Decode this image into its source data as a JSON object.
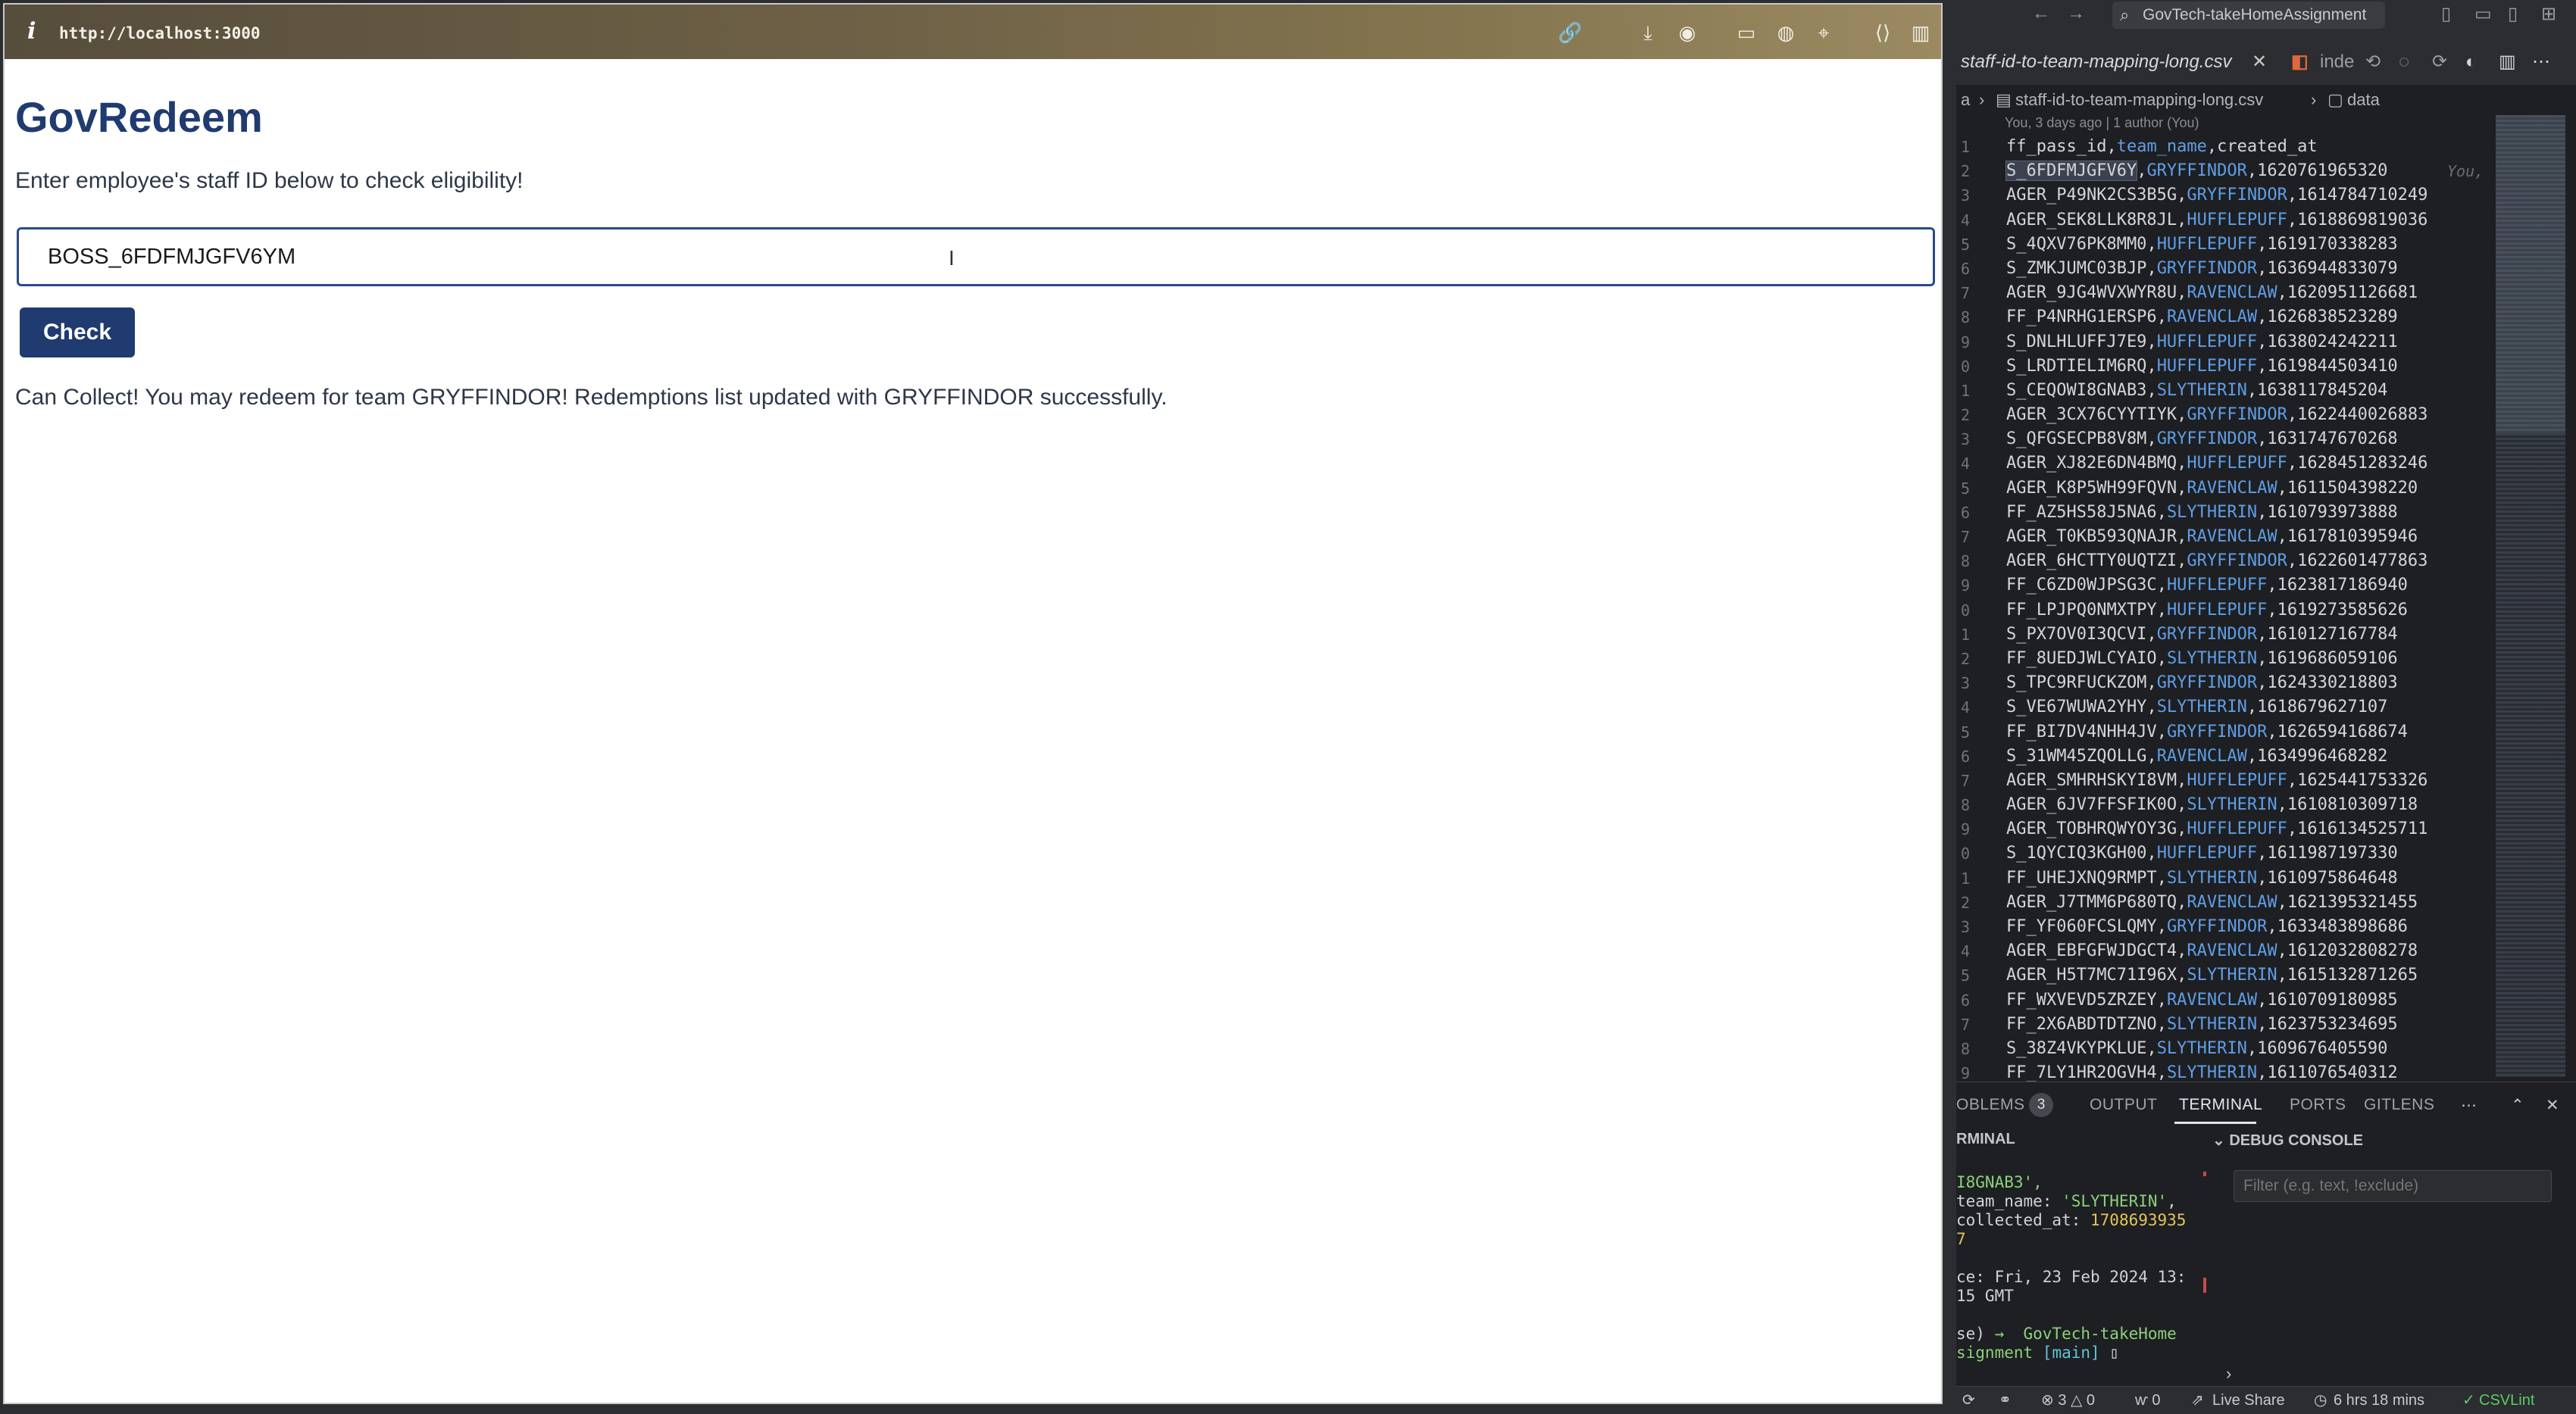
{
  "browser": {
    "url": "http://localhost:3000",
    "title": "GovRedeem",
    "prompt": "Enter employee's staff ID below to check eligibility!",
    "input_value": "BOSS_6FDFMJGFV6YM",
    "check_label": "Check",
    "result": "Can Collect! You may redeem for team GRYFFINDOR! Redemptions list updated with GRYFFINDOR successfully."
  },
  "editor": {
    "search": "GovTech-takeHomeAssignment",
    "tabs": [
      "staff-id-to-team-mapping-long.csv",
      "inde"
    ],
    "breadcrumb": [
      "a",
      "staff-id-to-team-mapping-long.csv",
      "data"
    ],
    "blame": "You, 3 days ago | 1 author (You)",
    "ghost_text": "You,",
    "header_line": {
      "cols": [
        "ff_pass_id",
        "team_name",
        "created_at"
      ]
    },
    "rows": [
      {
        "ln": "2",
        "id": "S_6FDFMJGFV6Y",
        "team": "GRYFFINDOR",
        "ts": "1620761965320"
      },
      {
        "ln": "3",
        "id": "AGER_P49NK2CS3B5G",
        "team": "GRYFFINDOR",
        "ts": "1614784710249"
      },
      {
        "ln": "4",
        "id": "AGER_SEK8LLK8R8JL",
        "team": "HUFFLEPUFF",
        "ts": "1618869819036"
      },
      {
        "ln": "5",
        "id": "S_4QXV76PK8MM0",
        "team": "HUFFLEPUFF",
        "ts": "1619170338283"
      },
      {
        "ln": "6",
        "id": "S_ZMKJUMC03BJP",
        "team": "GRYFFINDOR",
        "ts": "1636944833079"
      },
      {
        "ln": "7",
        "id": "AGER_9JG4WVXWYR8U",
        "team": "RAVENCLAW",
        "ts": "1620951126681"
      },
      {
        "ln": "8",
        "id": "FF_P4NRHG1ERSP6",
        "team": "RAVENCLAW",
        "ts": "1626838523289"
      },
      {
        "ln": "9",
        "id": "S_DNLHLUFFJ7E9",
        "team": "HUFFLEPUFF",
        "ts": "1638024242211"
      },
      {
        "ln": "0",
        "id": "S_LRDTIELIM6RQ",
        "team": "HUFFLEPUFF",
        "ts": "1619844503410"
      },
      {
        "ln": "1",
        "id": "S_CEQOWI8GNAB3",
        "team": "SLYTHERIN",
        "ts": "1638117845204"
      },
      {
        "ln": "2",
        "id": "AGER_3CX76CYYTIYK",
        "team": "GRYFFINDOR",
        "ts": "1622440026883"
      },
      {
        "ln": "3",
        "id": "S_QFGSECPB8V8M",
        "team": "GRYFFINDOR",
        "ts": "1631747670268"
      },
      {
        "ln": "4",
        "id": "AGER_XJ82E6DN4BMQ",
        "team": "HUFFLEPUFF",
        "ts": "1628451283246"
      },
      {
        "ln": "5",
        "id": "AGER_K8P5WH99FQVN",
        "team": "RAVENCLAW",
        "ts": "1611504398220"
      },
      {
        "ln": "6",
        "id": "FF_AZ5HS58J5NA6",
        "team": "SLYTHERIN",
        "ts": "1610793973888"
      },
      {
        "ln": "7",
        "id": "AGER_T0KB593QNAJR",
        "team": "RAVENCLAW",
        "ts": "1617810395946"
      },
      {
        "ln": "8",
        "id": "AGER_6HCTTY0UQTZI",
        "team": "GRYFFINDOR",
        "ts": "1622601477863"
      },
      {
        "ln": "9",
        "id": "FF_C6ZD0WJPSG3C",
        "team": "HUFFLEPUFF",
        "ts": "1623817186940"
      },
      {
        "ln": "0",
        "id": "FF_LPJPQ0NMXTPY",
        "team": "HUFFLEPUFF",
        "ts": "1619273585626"
      },
      {
        "ln": "1",
        "id": "S_PX7OV0I3QCVI",
        "team": "GRYFFINDOR",
        "ts": "1610127167784"
      },
      {
        "ln": "2",
        "id": "FF_8UEDJWLCYAIO",
        "team": "SLYTHERIN",
        "ts": "1619686059106"
      },
      {
        "ln": "3",
        "id": "S_TPC9RFUCKZOM",
        "team": "GRYFFINDOR",
        "ts": "1624330218803"
      },
      {
        "ln": "4",
        "id": "S_VE67WUWA2YHY",
        "team": "SLYTHERIN",
        "ts": "1618679627107"
      },
      {
        "ln": "5",
        "id": "FF_BI7DV4NHH4JV",
        "team": "GRYFFINDOR",
        "ts": "1626594168674"
      },
      {
        "ln": "6",
        "id": "S_31WM45ZQOLLG",
        "team": "RAVENCLAW",
        "ts": "1634996468282"
      },
      {
        "ln": "7",
        "id": "AGER_SMHRHSKYI8VM",
        "team": "HUFFLEPUFF",
        "ts": "1625441753326"
      },
      {
        "ln": "8",
        "id": "AGER_6JV7FFSFIK0O",
        "team": "SLYTHERIN",
        "ts": "1610810309718"
      },
      {
        "ln": "9",
        "id": "AGER_TOBHRQWYOY3G",
        "team": "HUFFLEPUFF",
        "ts": "1616134525711"
      },
      {
        "ln": "0",
        "id": "S_1QYCIQ3KGH00",
        "team": "HUFFLEPUFF",
        "ts": "1611987197330"
      },
      {
        "ln": "1",
        "id": "FF_UHEJXNQ9RMPT",
        "team": "SLYTHERIN",
        "ts": "1610975864648"
      },
      {
        "ln": "2",
        "id": "AGER_J7TMM6P680TQ",
        "team": "RAVENCLAW",
        "ts": "1621395321455"
      },
      {
        "ln": "3",
        "id": "FF_YF060FCSLQMY",
        "team": "GRYFFINDOR",
        "ts": "1633483898686"
      },
      {
        "ln": "4",
        "id": "AGER_EBFGFWJDGCT4",
        "team": "RAVENCLAW",
        "ts": "1612032808278"
      },
      {
        "ln": "5",
        "id": "AGER_H5T7MC71I96X",
        "team": "SLYTHERIN",
        "ts": "1615132871265"
      },
      {
        "ln": "6",
        "id": "FF_WXVEVD5ZRZEY",
        "team": "RAVENCLAW",
        "ts": "1610709180985"
      },
      {
        "ln": "7",
        "id": "FF_2X6ABDTDTZNO",
        "team": "SLYTHERIN",
        "ts": "1623753234695"
      },
      {
        "ln": "8",
        "id": "S_38Z4VKYPKLUE",
        "team": "SLYTHERIN",
        "ts": "1609676405590"
      },
      {
        "ln": "9",
        "id": "FF_7LY1HR2OGVH4",
        "team": "SLYTHERIN",
        "ts": "1611076540312"
      }
    ],
    "panel": {
      "tabs": [
        "OBLEMS",
        "OUTPUT",
        "TERMINAL",
        "PORTS",
        "GITLENS"
      ],
      "problems_count": "3",
      "terminal_title": "RMINAL",
      "debug_title": "DEBUG CONSOLE",
      "filter_placeholder": "Filter (e.g. text, !exclude)",
      "terminal_lines": {
        "l1": "I8GNAB3',",
        "l2a": "team_name: ",
        "l2b": "'SLYTHERIN'",
        "l2c": ",",
        "l3a": "collected_at: ",
        "l3b": "1708693935",
        "l4": "7",
        "l5": "",
        "l6": "ce: Fri, 23 Feb 2024 13:",
        "l7": "15 GMT",
        "l8": "",
        "l9a": "se) ",
        "l9b": "→  GovTech-takeHome",
        "l10a": "signment ",
        "l10b": "[main]",
        "l10c": " ▯"
      }
    },
    "status": {
      "problems": "⊗ 3 △ 0",
      "ports": "ⱳ 0",
      "liveshare": "Live Share",
      "time": "6 hrs 18 mins",
      "csvlint": "CSVLint"
    }
  }
}
